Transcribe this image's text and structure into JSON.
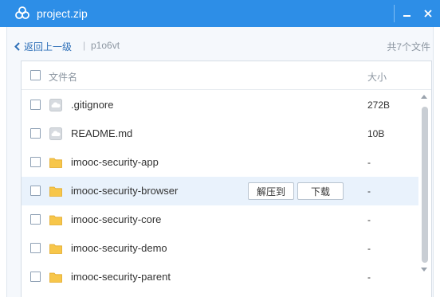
{
  "window": {
    "title": "project.zip",
    "brand_color": "#2d8ee7",
    "logo_icon": "cloud-logo-icon",
    "minimize_icon": "minimize-icon",
    "close_icon": "close-icon"
  },
  "nav": {
    "back_label": "返回上一级",
    "separator": "|",
    "current_folder": "p1o6vt",
    "total_count": "共7个文件"
  },
  "table": {
    "col_name": "文件名",
    "col_size": "大小"
  },
  "files": [
    {
      "name": ".gitignore",
      "size": "272B",
      "icon": "file-icon"
    },
    {
      "name": "README.md",
      "size": "10B",
      "icon": "file-icon"
    },
    {
      "name": "imooc-security-app",
      "size": "-",
      "icon": "folder-icon"
    },
    {
      "name": "imooc-security-browser",
      "size": "-",
      "icon": "folder-icon",
      "extract_label": "解压到",
      "download_label": "下载"
    },
    {
      "name": "imooc-security-core",
      "size": "-",
      "icon": "folder-icon"
    },
    {
      "name": "imooc-security-demo",
      "size": "-",
      "icon": "folder-icon"
    },
    {
      "name": "imooc-security-parent",
      "size": "-",
      "icon": "folder-icon"
    }
  ]
}
